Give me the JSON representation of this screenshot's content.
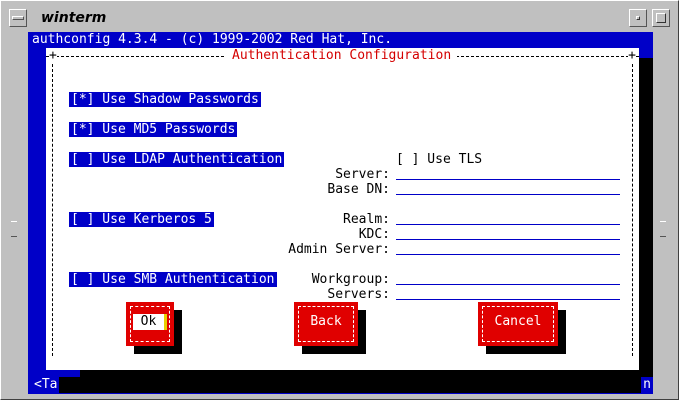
{
  "window": {
    "title": "winterm"
  },
  "terminal": {
    "header": "authconfig 4.3.4 - (c) 1999-2002 Red Hat, Inc.",
    "status_left": "<Ta",
    "status_right": "n"
  },
  "dialog": {
    "title": "Authentication Configuration",
    "options": {
      "shadow": "[*] Use Shadow Passwords",
      "md5": "[*] Use MD5 Passwords",
      "ldap": "[ ] Use LDAP Authentication",
      "kerberos": "[ ] Use Kerberos 5",
      "smb": "[ ] Use SMB Authentication",
      "tls": "[ ] Use TLS"
    },
    "fields": {
      "server": "Server:",
      "base_dn": "Base DN:",
      "realm": "Realm:",
      "kdc": "KDC:",
      "admin_server": "Admin Server:",
      "workgroup": "Workgroup:",
      "servers": "Servers:"
    },
    "buttons": {
      "ok": "Ok",
      "back": "Back",
      "cancel": "Cancel"
    }
  },
  "colors": {
    "terminal_bg": "#0000c8",
    "dialog_bg": "#ffffff",
    "title_color": "#d40000",
    "button_bg": "#e00000"
  }
}
